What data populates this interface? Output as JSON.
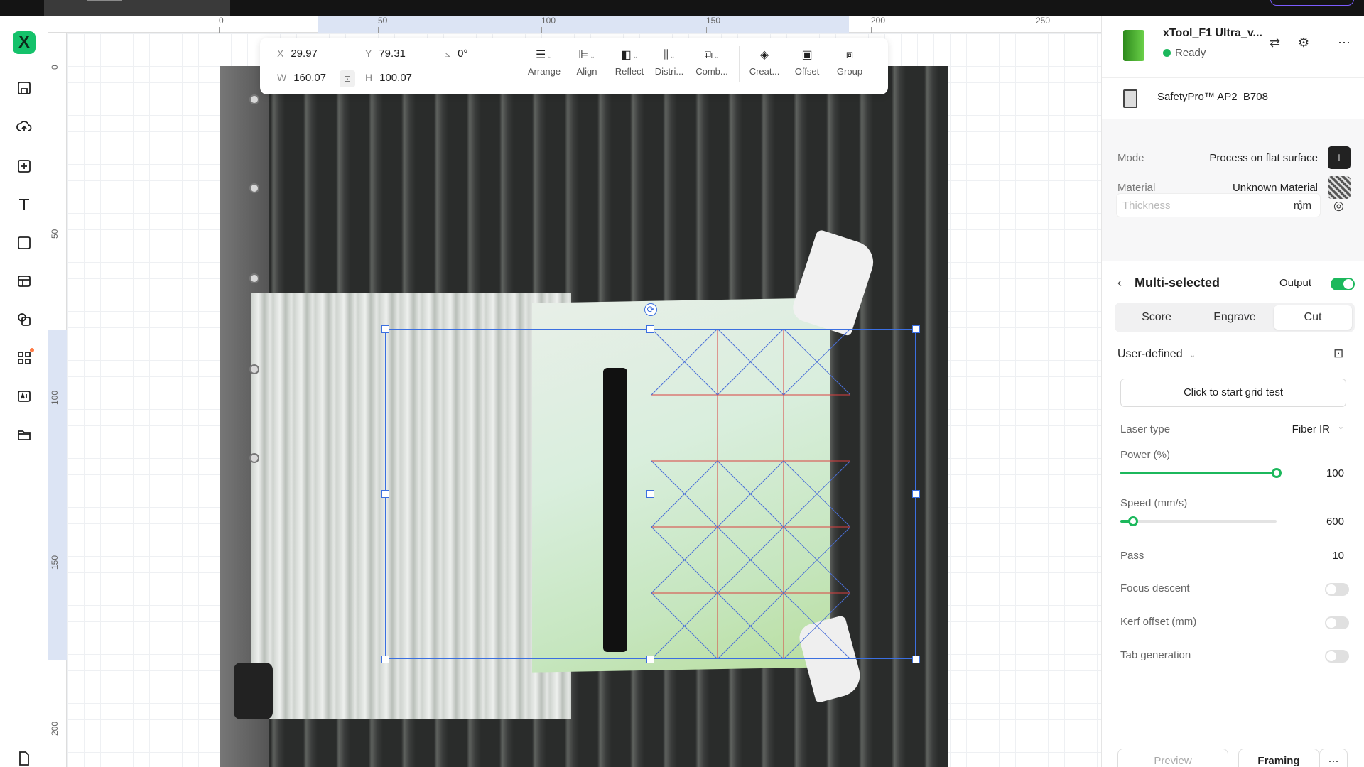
{
  "toolbar_left": {
    "logo": "X",
    "tools": [
      "save-icon",
      "upload-cloud-icon",
      "add-box-icon",
      "text-icon",
      "shape-icon",
      "layout-icon",
      "copy-shapes-icon",
      "apps-icon",
      "ai-image-icon",
      "folder-icon",
      "file-icon"
    ]
  },
  "ruler": {
    "h_ticks": [
      "0",
      "50",
      "100",
      "150",
      "200",
      "250"
    ],
    "v_ticks": [
      "0",
      "50",
      "100",
      "150",
      "200"
    ]
  },
  "props": {
    "x_label": "X",
    "x": "29.97",
    "y_label": "Y",
    "y": "79.31",
    "w_label": "W",
    "w": "160.07",
    "h_label": "H",
    "h": "100.07",
    "rotation": "0°",
    "tools": [
      {
        "label": "Arrange",
        "icon": "arrange-icon"
      },
      {
        "label": "Align",
        "icon": "align-icon"
      },
      {
        "label": "Reflect",
        "icon": "reflect-icon"
      },
      {
        "label": "Distri...",
        "icon": "distribute-icon"
      },
      {
        "label": "Comb...",
        "icon": "combine-icon"
      },
      {
        "label": "Creat...",
        "icon": "create-icon"
      },
      {
        "label": "Offset",
        "icon": "offset-icon"
      },
      {
        "label": "Group",
        "icon": "group-icon"
      }
    ]
  },
  "device": {
    "name": "xTool_F1 Ultra_v...",
    "status": "Ready",
    "status_color": "#1cb85c",
    "module": "SafetyPro™ AP2_B708"
  },
  "settings": {
    "mode_label": "Mode",
    "mode_value": "Process on flat surface",
    "material_label": "Material",
    "material_value": "Unknown Material",
    "thickness_placeholder": "Thickness",
    "thickness_unit": "mm"
  },
  "processing": {
    "title": "Multi-selected",
    "output_label": "Output",
    "output_on": true,
    "tabs": [
      "Score",
      "Engrave",
      "Cut"
    ],
    "active_tab": "Cut",
    "preset": "User-defined",
    "grid_test_button": "Click to start grid test",
    "laser_type_label": "Laser type",
    "laser_type_value": "Fiber IR",
    "power_label": "Power (%)",
    "power_value": "100",
    "power_fraction": 1.0,
    "speed_label": "Speed (mm/s)",
    "speed_value": "600",
    "speed_fraction": 0.08,
    "pass_label": "Pass",
    "pass_value": "10",
    "focus_descent_label": "Focus descent",
    "kerf_offset_label": "Kerf offset (mm)",
    "tab_generation_label": "Tab generation"
  },
  "footer": {
    "preview": "Preview",
    "framing": "Framing",
    "more": "···"
  },
  "colors": {
    "accent": "#1cb85c",
    "selection": "#3b6fe0",
    "grid_lines_red": "#d94040",
    "grid_lines_blue": "#4a6fd8"
  }
}
